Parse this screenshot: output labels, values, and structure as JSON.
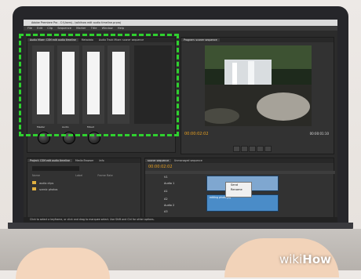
{
  "app": {
    "window_title": "Adobe Premiere Pro - C:\\Users\\...\\wikihow edit audio timeline.prproj",
    "menu": [
      "File",
      "Edit",
      "Clip",
      "Sequence",
      "Marker",
      "Title",
      "Window",
      "Help"
    ]
  },
  "mixer": {
    "tabs": [
      "Audio Mixer: CSM edit audio timeline",
      "Metadata",
      "Audio Track Mixer: sconer sequence"
    ],
    "tracks": [
      "Audio 1",
      "Audio 2",
      "Audio 3",
      "Master"
    ],
    "knobs": [
      "Master",
      "Audio",
      "Mixed"
    ]
  },
  "monitor": {
    "tabs": [
      "Program: sconer sequence"
    ],
    "timecode_in": "00:00:02:02",
    "timecode_out": "00:00:01:10"
  },
  "project": {
    "tabs": [
      "Project: CSM edit audio timeline",
      "Media Browser",
      "Info"
    ],
    "search_placeholder": "",
    "items": [
      {
        "name": "audio clips"
      },
      {
        "name": "scenic photos"
      }
    ],
    "columns": [
      "Name",
      "Label",
      "Frame Rate"
    ]
  },
  "timeline": {
    "tabs": [
      "sconer sequence",
      "Unmanaged sequence"
    ],
    "timecode": "00:00:02:02",
    "track_labels": [
      "V1",
      "Audio 1",
      "A1",
      "A2",
      "Audio 2",
      "A3"
    ],
    "context_menu": [
      "Send",
      "Rename"
    ],
    "clip_label": "editing photo.jpg"
  },
  "status": {
    "text": "Click to select a keyframe, or click and drag to marquee select. Use Shift and Ctrl for other options."
  },
  "colors": {
    "highlight": "#2fd12f",
    "timecode": "#e8a020",
    "audio_clip": "#4a8cc8",
    "video_clip": "#7fa7d0"
  },
  "watermark": {
    "wiki": "wiki",
    "how": "How"
  }
}
